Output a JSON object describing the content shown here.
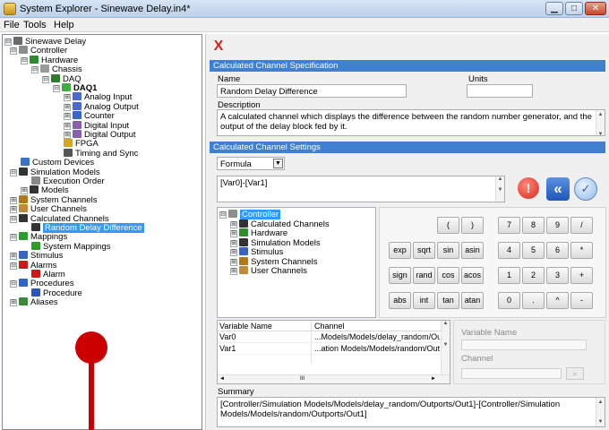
{
  "window": {
    "title": "System Explorer - Sinewave Delay.in4*",
    "minimize": "▁",
    "maximize": "□",
    "close": "✕"
  },
  "menu": {
    "file": "File",
    "tools": "Tools",
    "help": "Help"
  },
  "tree": [
    {
      "label": "Sinewave Delay",
      "exp": "⊟",
      "icon": "project-icon",
      "color": "#6a6a6a"
    },
    {
      "label": "Controller",
      "exp": "⊟",
      "icon": "controller-icon",
      "color": "#8d8d8d"
    },
    {
      "label": "Hardware",
      "exp": "⊟",
      "icon": "hardware-icon",
      "color": "#2e8b2e"
    },
    {
      "label": "Chassis",
      "exp": "⊟",
      "icon": "chassis-icon",
      "color": "#9a9a9a"
    },
    {
      "label": "DAQ",
      "exp": "⊟",
      "icon": "daq-icon",
      "color": "#2d7b2d"
    },
    {
      "label": "DAQ1",
      "exp": "⊟",
      "icon": "daq-device-icon",
      "color": "#3fae3f"
    },
    {
      "label": "Analog Input",
      "exp": "⊞",
      "icon": "analog-input-icon",
      "color": "#4a6ad0"
    },
    {
      "label": "Analog Output",
      "exp": "⊞",
      "icon": "analog-output-icon",
      "color": "#4a6ad0"
    },
    {
      "label": "Counter",
      "exp": "⊞",
      "icon": "counter-icon",
      "color": "#3a66c4"
    },
    {
      "label": "Digital Input",
      "exp": "⊞",
      "icon": "digital-input-icon",
      "color": "#8a5fb0"
    },
    {
      "label": "Digital Output",
      "exp": "⊞",
      "icon": "digital-output-icon",
      "color": "#8a5fb0"
    },
    {
      "label": "FPGA",
      "exp": "",
      "icon": "fpga-icon",
      "color": "#d8a51d"
    },
    {
      "label": "Timing and Sync",
      "exp": "",
      "icon": "timing-icon",
      "color": "#555"
    },
    {
      "label": "Custom Devices",
      "exp": "",
      "icon": "custom-devices-icon",
      "color": "#3b73c8"
    },
    {
      "label": "Simulation Models",
      "exp": "⊟",
      "icon": "simulation-models-icon",
      "color": "#333"
    },
    {
      "label": "Execution Order",
      "exp": "",
      "icon": "execution-order-icon",
      "color": "#888"
    },
    {
      "label": "Models",
      "exp": "⊞",
      "icon": "models-icon",
      "color": "#333"
    },
    {
      "label": "System Channels",
      "exp": "⊞",
      "icon": "system-channels-icon",
      "color": "#b07a1a"
    },
    {
      "label": "User Channels",
      "exp": "⊞",
      "icon": "user-channels-icon",
      "color": "#c08a3a"
    },
    {
      "label": "Calculated Channels",
      "exp": "⊟",
      "icon": "calculated-channels-icon",
      "color": "#333"
    },
    {
      "label": "Random Delay Difference",
      "exp": "",
      "icon": "calculated-channel-icon",
      "color": "#333"
    },
    {
      "label": "Mappings",
      "exp": "⊟",
      "icon": "mappings-icon",
      "color": "#2b9d2b"
    },
    {
      "label": "System Mappings",
      "exp": "",
      "icon": "system-mappings-icon",
      "color": "#2b9d2b"
    },
    {
      "label": "Stimulus",
      "exp": "⊞",
      "icon": "stimulus-icon",
      "color": "#3a63c6"
    },
    {
      "label": "Alarms",
      "exp": "⊟",
      "icon": "alarms-icon",
      "color": "#d01818"
    },
    {
      "label": "Alarm",
      "exp": "",
      "icon": "alarm-icon",
      "color": "#d01818"
    },
    {
      "label": "Procedures",
      "exp": "⊟",
      "icon": "procedures-icon",
      "color": "#2f64c8"
    },
    {
      "label": "Procedure",
      "exp": "",
      "icon": "procedure-icon",
      "color": "#2a56b8"
    },
    {
      "label": "Aliases",
      "exp": "⊞",
      "icon": "aliases-icon",
      "color": "#3a8a3a"
    }
  ],
  "right": {
    "close_icon": "X",
    "spec_header": "Calculated Channel Specification",
    "name_label": "Name",
    "units_label": "Units",
    "name_value": "Random Delay Difference",
    "units_value": "",
    "description_label": "Description",
    "description_value": "A calculated channel which displays the difference between the random number generator, and the output of the delay block fed by it.",
    "settings_header": "Calculated Channel Settings",
    "mode": "Formula",
    "formula": "[Var0]-[Var1]",
    "channel_tree": [
      {
        "label": "Controller",
        "exp": "⊟",
        "icon": "controller-icon",
        "color": "#8d8d8d",
        "sel": true
      },
      {
        "label": "Calculated Channels",
        "exp": "⊞",
        "icon": "calculated-channels-icon",
        "color": "#333"
      },
      {
        "label": "Hardware",
        "exp": "⊞",
        "icon": "hardware-icon",
        "color": "#2e8b2e"
      },
      {
        "label": "Simulation Models",
        "exp": "⊞",
        "icon": "simulation-models-icon",
        "color": "#333"
      },
      {
        "label": "Stimulus",
        "exp": "⊞",
        "icon": "stimulus-icon",
        "color": "#3a63c6"
      },
      {
        "label": "System Channels",
        "exp": "⊞",
        "icon": "system-channels-icon",
        "color": "#b07a1a"
      },
      {
        "label": "User Channels",
        "exp": "⊞",
        "icon": "user-channels-icon",
        "color": "#c08a3a"
      }
    ],
    "keypad": [
      [
        "",
        "",
        "(",
        ")",
        "",
        "7",
        "8",
        "9",
        "/"
      ],
      [
        "exp",
        "sqrt",
        "sin",
        "asin",
        "",
        "4",
        "5",
        "6",
        "*"
      ],
      [
        "sign",
        "rand",
        "cos",
        "acos",
        "",
        "1",
        "2",
        "3",
        "+"
      ],
      [
        "abs",
        "int",
        "tan",
        "atan",
        "",
        "0",
        ".",
        "^",
        "-"
      ]
    ],
    "var_table": {
      "col_name": "Variable Name",
      "col_channel": "Channel",
      "rows": [
        {
          "name": "Var0",
          "channel": "...Models/Models/delay_random/Outpo"
        },
        {
          "name": "Var1",
          "channel": "...ation Models/Models/random/Outpor"
        }
      ]
    },
    "var_name_label": "Variable Name",
    "channel_label": "Channel",
    "summary_label": "Summary",
    "summary_value": "[Controller/Simulation Models/Models/delay_random/Outports/Out1]-[Controller/Simulation Models/Models/random/Outports/Out1]",
    "scroll_mid": "III"
  },
  "colors": {
    "accent": "#3f80d0",
    "selection": "#3399ff",
    "marker": "#cc0000"
  }
}
